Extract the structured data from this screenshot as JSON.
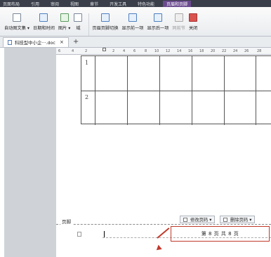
{
  "menu": [
    "页面布局",
    "引用",
    "审阅",
    "视图",
    "章节",
    "开发工具",
    "特色功能",
    "页眉和页脚"
  ],
  "ribbon": {
    "buttons": [
      {
        "label": "自动图文集 ▾"
      },
      {
        "label": "日期和时间"
      },
      {
        "label": "图片 ▾"
      },
      {
        "label": "域"
      },
      {
        "label": "页眉页脚切换"
      },
      {
        "label": "显示前一项"
      },
      {
        "label": "显示后一项"
      },
      {
        "label": "同前节"
      },
      {
        "label": "关闭"
      }
    ]
  },
  "tab": {
    "title": "科技型中小企···.doc",
    "close": "×",
    "new": "+"
  },
  "ruler": [
    "6",
    "4",
    "2",
    "2",
    "4",
    "6",
    "8",
    "10",
    "12",
    "14",
    "16",
    "18",
    "20",
    "22",
    "24",
    "26",
    "28"
  ],
  "table": {
    "rows": [
      "1",
      "2"
    ]
  },
  "footer": {
    "label": "页脚",
    "edit_button": "修改页码 ▾",
    "delete_button": "删除页码 ▾",
    "page_text": "第 8 页 共 8 页"
  }
}
